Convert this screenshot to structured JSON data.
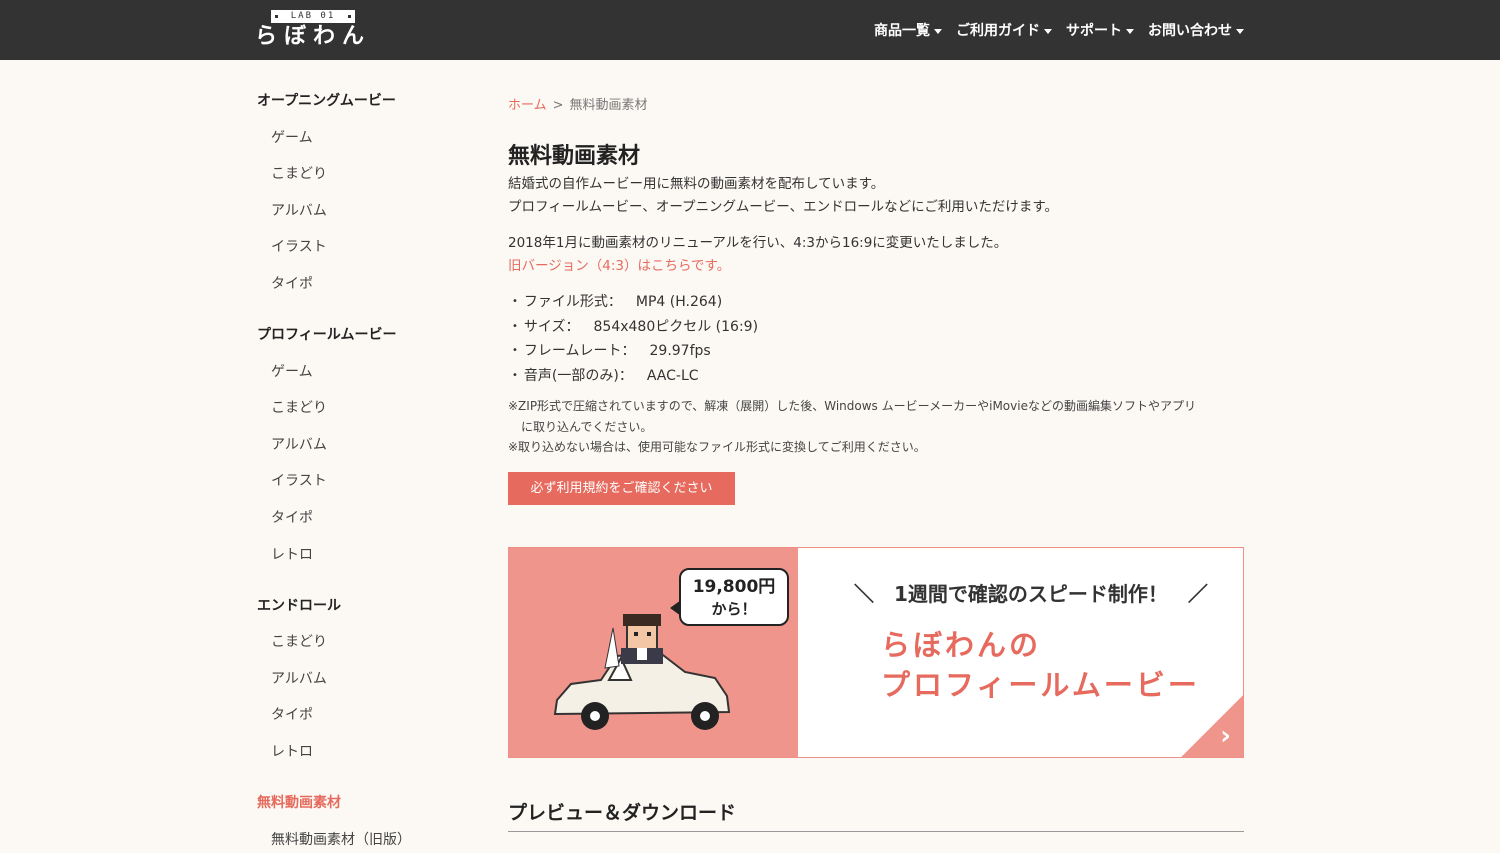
{
  "header": {
    "logo_badge": "LAB 01",
    "logo_text": "らぼわん",
    "nav": [
      {
        "label": "商品一覧"
      },
      {
        "label": "ご利用ガイド"
      },
      {
        "label": "サポート"
      },
      {
        "label": "お問い合わせ"
      }
    ]
  },
  "sidebar": {
    "groups": [
      {
        "title": "オープニングムービー",
        "items": [
          "ゲーム",
          "こまどり",
          "アルバム",
          "イラスト",
          "タイポ"
        ]
      },
      {
        "title": "プロフィールムービー",
        "items": [
          "ゲーム",
          "こまどり",
          "アルバム",
          "イラスト",
          "タイポ",
          "レトロ"
        ]
      },
      {
        "title": "エンドロール",
        "items": [
          "こまどり",
          "アルバム",
          "タイポ",
          "レトロ"
        ]
      },
      {
        "title": "無料動画素材",
        "items": [
          "無料動画素材（旧版）"
        ]
      }
    ]
  },
  "main": {
    "breadcrumb_home": "ホーム",
    "breadcrumb_sep": ">",
    "breadcrumb_current": "無料動画素材",
    "title": "無料動画素材",
    "intro1": "結婚式の自作ムービー用に無料の動画素材を配布しています。",
    "intro2": "プロフィールムービー、オープニングムービー、エンドロールなどにご利用いただけます。",
    "renewal": "2018年1月に動画素材のリニューアルを行い、4:3から16:9に変更いたしました。",
    "old_version_link": "旧バージョン（4:3）はこちらです。",
    "specs": [
      {
        "label": "ファイル形式：",
        "value": "MP4 (H.264)"
      },
      {
        "label": "サイズ：",
        "value": "854x480ピクセル (16:9)"
      },
      {
        "label": "フレームレート：",
        "value": "29.97fps"
      },
      {
        "label": "音声(一部のみ)：",
        "value": "AAC-LC"
      }
    ],
    "note1a": "※ZIP形式で圧縮されていますので、解凍（展開）した後、Windows ムービーメーカーやiMovieなどの動画編集ソフトやアプリ",
    "note1b": "に取り込んでください。",
    "note2": "※取り込めない場合は、使用可能なファイル形式に変換してご利用ください。",
    "terms_button": "必ず利用規約をご確認ください",
    "banner": {
      "price": "19,800円",
      "from": "から！",
      "tagline": "＼　1週間で確認のスピード制作！　／",
      "title1": "らぼわんの",
      "title2": "プロフィールムービー",
      "arrow": "›"
    },
    "section_title": "プレビュー＆ダウンロード"
  },
  "colors": {
    "accent": "#e66b5e",
    "header_bg": "#333333",
    "page_bg": "#fcf9f4",
    "banner_pink": "#f0958b"
  }
}
